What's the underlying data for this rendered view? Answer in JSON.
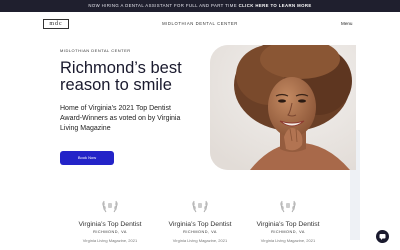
{
  "announcement": {
    "text": "NOW HIRING A DENTAL ASSISTANT FOR FULL AND PART TIME",
    "link": "CLICK HERE TO LEARN MORE"
  },
  "header": {
    "logo_text": "mdc",
    "site_name": "MIDLOTHIAN DENTAL CENTER",
    "menu_label": "Menu"
  },
  "hero": {
    "eyebrow": "MIDLOTHIAN DENTAL CENTER",
    "headline": "Richmond’s best reason to smile",
    "subtext": "Home of Virginia’s 2021 Top Dentist Award-Winners as voted on by Virginia Living Magazine",
    "cta_label": "Book Now"
  },
  "awards": [
    {
      "title": "Virginia’s Top Dentist",
      "location": "RICHMOND, VA",
      "source": "Virginia Living Magazine, 2021"
    },
    {
      "title": "Virginia’s Top Dentist",
      "location": "RICHMOND, VA",
      "source": "Virginia Living Magazine, 2021"
    },
    {
      "title": "Virginia’s Top Dentist",
      "location": "RICHMOND, VA",
      "source": "Virginia Living Magazine, 2021"
    }
  ],
  "colors": {
    "accent": "#2323c8",
    "dark": "#1f1f2e"
  },
  "icons": {
    "chat": "chat-icon",
    "award": "laurel-icon"
  }
}
